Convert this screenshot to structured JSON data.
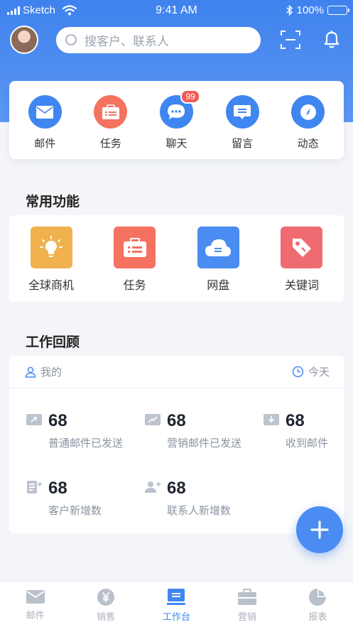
{
  "status_bar": {
    "carrier": "Sketch",
    "time": "9:41 AM",
    "battery": "100%"
  },
  "header": {
    "search_placeholder": "搜客户、联系人"
  },
  "quick_actions": [
    {
      "label": "邮件",
      "icon": "mail-icon",
      "color": "#3f86f0"
    },
    {
      "label": "任务",
      "icon": "task-icon",
      "color": "#f4725f"
    },
    {
      "label": "聊天",
      "icon": "chat-icon",
      "color": "#3f86f0",
      "badge": "99"
    },
    {
      "label": "留言",
      "icon": "message-icon",
      "color": "#3f86f0"
    },
    {
      "label": "动态",
      "icon": "compass-icon",
      "color": "#3f86f0"
    }
  ],
  "common_functions": {
    "title": "常用功能",
    "items": [
      {
        "label": "全球商机",
        "icon": "lightbulb-icon",
        "color": "#f0b14e"
      },
      {
        "label": "任务",
        "icon": "task-icon",
        "color": "#f4725f"
      },
      {
        "label": "网盘",
        "icon": "cloud-icon",
        "color": "#4a8cf1"
      },
      {
        "label": "关键词",
        "icon": "tag-icon",
        "color": "#f06b71"
      }
    ]
  },
  "work_review": {
    "title": "工作回顾",
    "scope_label": "我的",
    "period_label": "今天",
    "stats": [
      {
        "value": "68",
        "label": "普通邮件已发送",
        "icon": "mail-sent-icon"
      },
      {
        "value": "68",
        "label": "营销邮件已发送",
        "icon": "marketing-mail-icon"
      },
      {
        "value": "68",
        "label": "收到邮件",
        "icon": "mail-received-icon"
      },
      {
        "value": "68",
        "label": "客户新增数",
        "icon": "customer-add-icon"
      },
      {
        "value": "68",
        "label": "联系人新增数",
        "icon": "contact-add-icon"
      }
    ]
  },
  "fab": {
    "label": "+"
  },
  "tab_bar": {
    "active": "工作台",
    "tabs": [
      {
        "label": "邮件",
        "icon": "mail-icon"
      },
      {
        "label": "销售",
        "icon": "yen-icon"
      },
      {
        "label": "工作台",
        "icon": "workbench-icon"
      },
      {
        "label": "营销",
        "icon": "briefcase-icon"
      },
      {
        "label": "报表",
        "icon": "pie-chart-icon"
      }
    ]
  }
}
